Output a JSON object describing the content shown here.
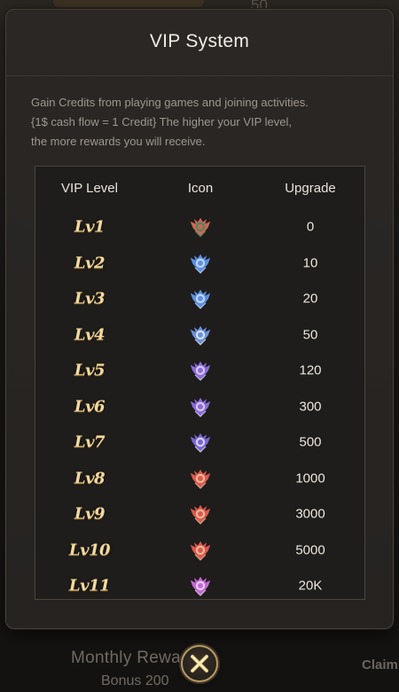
{
  "background": {
    "top_number": "50",
    "monthly_label": "Monthly Rewa",
    "bonus_label": "Bonus 200",
    "claim_label": "Claim"
  },
  "modal": {
    "title": "VIP System",
    "description_line1": "Gain Credits from playing games and joining activities.",
    "description_line2": "{1$ cash flow = 1 Credit} The higher your VIP level,",
    "description_line3": "the more rewards you will receive."
  },
  "table": {
    "headers": {
      "level": "VIP Level",
      "icon": "Icon",
      "upgrade": "Upgrade"
    },
    "rows": [
      {
        "level": "Lv1",
        "icon": "vip-badge-bronze-icon",
        "icon_color": "#c96a55",
        "accent": "#3d8a62",
        "upgrade": "0"
      },
      {
        "level": "Lv2",
        "icon": "vip-badge-blue-icon",
        "icon_color": "#5d8fe0",
        "accent": "#cfe2ff",
        "upgrade": "10"
      },
      {
        "level": "Lv3",
        "icon": "vip-badge-blue-icon",
        "icon_color": "#5d8fe0",
        "accent": "#cfe2ff",
        "upgrade": "20"
      },
      {
        "level": "Lv4",
        "icon": "vip-badge-blue-icon",
        "icon_color": "#6c90d8",
        "accent": "#e6eefc",
        "upgrade": "50"
      },
      {
        "level": "Lv5",
        "icon": "vip-badge-purple-icon",
        "icon_color": "#8b6ad8",
        "accent": "#e3d8ff",
        "upgrade": "120"
      },
      {
        "level": "Lv6",
        "icon": "vip-badge-purple-icon",
        "icon_color": "#8b6ad8",
        "accent": "#e3d8ff",
        "upgrade": "300"
      },
      {
        "level": "Lv7",
        "icon": "vip-badge-purple-icon",
        "icon_color": "#7a66d0",
        "accent": "#e9e3ff",
        "upgrade": "500"
      },
      {
        "level": "Lv8",
        "icon": "vip-badge-red-icon",
        "icon_color": "#d8594f",
        "accent": "#f4c6a0",
        "upgrade": "1000"
      },
      {
        "level": "Lv9",
        "icon": "vip-badge-red-icon",
        "icon_color": "#d8594f",
        "accent": "#f4c6a0",
        "upgrade": "3000"
      },
      {
        "level": "Lv10",
        "icon": "vip-badge-red-icon",
        "icon_color": "#d8594f",
        "accent": "#f4c6a0",
        "upgrade": "5000"
      },
      {
        "level": "Lv11",
        "icon": "vip-badge-pink-icon",
        "icon_color": "#c06ad0",
        "accent": "#f2d8ff",
        "upgrade": "20K"
      }
    ]
  },
  "close_button": {
    "icon": "close-icon",
    "color": "#e6d08a"
  }
}
